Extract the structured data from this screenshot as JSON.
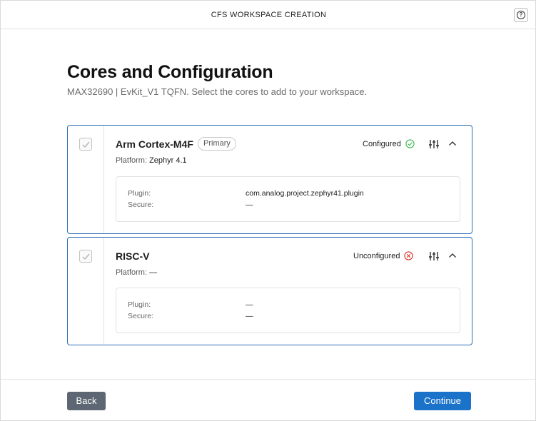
{
  "window": {
    "title": "CFS WORKSPACE CREATION",
    "help_icon": "help-circle-icon",
    "help_glyph": "?"
  },
  "page": {
    "title": "Cores and Configuration",
    "subtitle": "MAX32690 | EvKit_V1 TQFN. Select the cores to add to your workspace."
  },
  "cores": [
    {
      "name": "Arm Cortex-M4F",
      "badge": "Primary",
      "checked": true,
      "platform_label": "Platform:",
      "platform_value": "Zephyr 4.1",
      "status": "Configured",
      "status_icon": "check-circle-icon",
      "status_color": "#3fb950",
      "details": {
        "plugin_label": "Plugin:",
        "plugin_value": "com.analog.project.zephyr41.plugin",
        "secure_label": "Secure:",
        "secure_value": "—"
      }
    },
    {
      "name": "RISC-V",
      "badge": "",
      "checked": true,
      "platform_label": "Platform:",
      "platform_value": "—",
      "status": "Unconfigured",
      "status_icon": "x-circle-icon",
      "status_color": "#d93025",
      "details": {
        "plugin_label": "Plugin:",
        "plugin_value": "—",
        "secure_label": "Secure:",
        "secure_value": "—"
      }
    }
  ],
  "footer": {
    "back_label": "Back",
    "continue_label": "Continue"
  },
  "colors": {
    "accent": "#1a73c8",
    "card_border": "#2f6fb5",
    "back_button": "#5c6773"
  }
}
